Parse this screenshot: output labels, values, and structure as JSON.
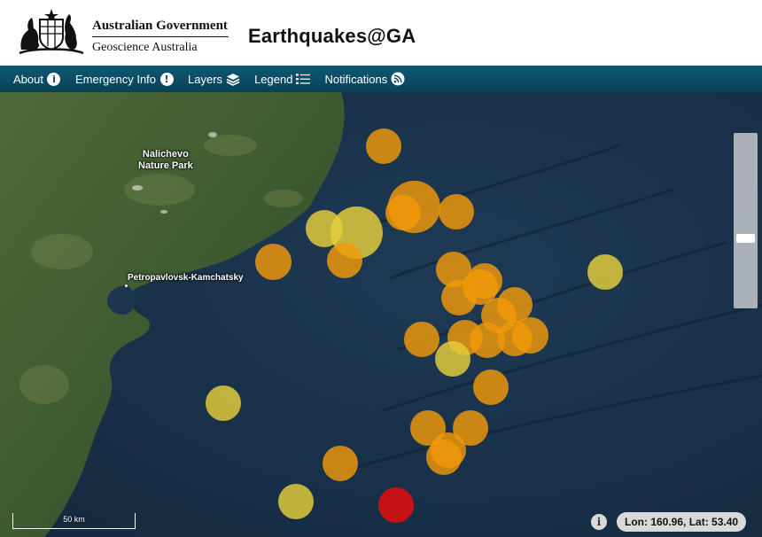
{
  "header": {
    "government": "Australian Government",
    "agency": "Geoscience Australia",
    "app_title": "Earthquakes@GA"
  },
  "nav": {
    "items": [
      {
        "label": "About",
        "icon": "info-icon"
      },
      {
        "label": "Emergency Info",
        "icon": "alert-icon"
      },
      {
        "label": "Layers",
        "icon": "layers-icon"
      },
      {
        "label": "Legend",
        "icon": "list-icon"
      },
      {
        "label": "Notifications",
        "icon": "rss-icon"
      }
    ]
  },
  "map": {
    "labels": {
      "park_line1": "Nalichevo",
      "park_line2": "Nature Park",
      "city": "Petropavlovsk-Kamchatsky"
    },
    "scale_label": "50 km",
    "coordinates": "Lon: 160.96, Lat: 53.40",
    "colors": {
      "orange": "#f29a08",
      "yellow": "#e6cf3c",
      "red": "#d81010"
    }
  }
}
